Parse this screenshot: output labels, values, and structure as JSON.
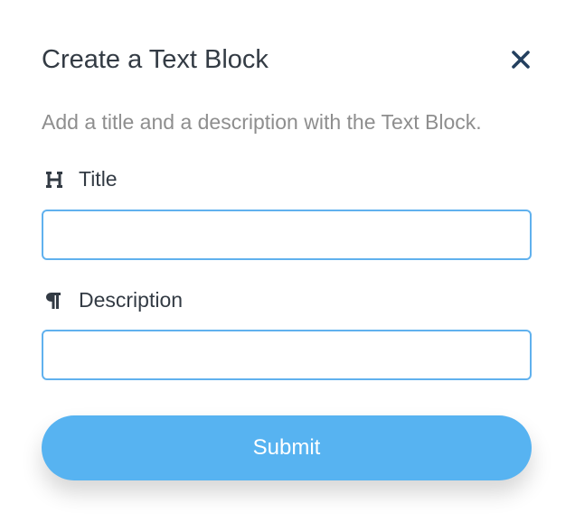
{
  "dialog": {
    "title": "Create a Text Block",
    "close_icon": "close-icon",
    "subtitle": "Add a title and a description with the Text Block.",
    "fields": {
      "title": {
        "icon": "heading-icon",
        "label": "Title",
        "value": "",
        "placeholder": ""
      },
      "description": {
        "icon": "paragraph-icon",
        "label": "Description",
        "value": "",
        "placeholder": ""
      }
    },
    "submit_label": "Submit"
  },
  "colors": {
    "title_text": "#333b44",
    "subtitle_text": "#8e8e8e",
    "close_icon": "#24405f",
    "input_border": "#60b1ee",
    "submit_bg": "#57b3f1",
    "submit_text": "#ffffff"
  }
}
